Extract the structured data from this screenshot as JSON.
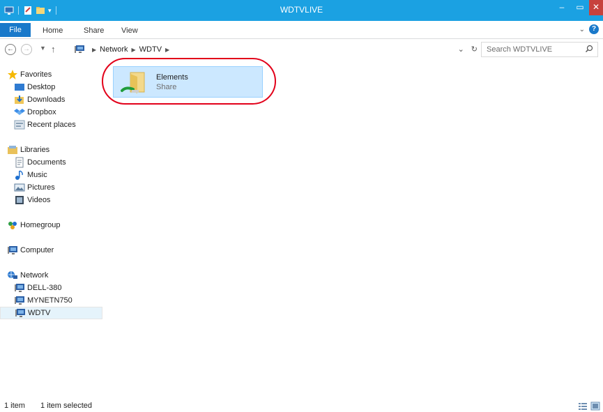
{
  "window": {
    "title": "WDTVLIVE"
  },
  "ribbon": {
    "tabs": [
      "File",
      "Home",
      "Share",
      "View"
    ]
  },
  "address": {
    "breadcrumb": [
      "Network",
      "WDTV"
    ],
    "search_placeholder": "Search WDTVLIVE"
  },
  "nav": {
    "favorites": {
      "label": "Favorites",
      "items": [
        "Desktop",
        "Downloads",
        "Dropbox",
        "Recent places"
      ]
    },
    "libraries": {
      "label": "Libraries",
      "items": [
        "Documents",
        "Music",
        "Pictures",
        "Videos"
      ]
    },
    "homegroup": "Homegroup",
    "computer": "Computer",
    "network": {
      "label": "Network",
      "items": [
        "DELL-380",
        "MYNETN750",
        "WDTV"
      ]
    }
  },
  "content": {
    "items": [
      {
        "name": "Elements",
        "type": "Share"
      }
    ]
  },
  "status": {
    "count": "1 item",
    "selected": "1 item selected"
  },
  "colors": {
    "titlebar": "#1ba1e2",
    "file_tab": "#1979ca",
    "selection": "#cce8ff",
    "highlight_ring": "#e2001a"
  }
}
